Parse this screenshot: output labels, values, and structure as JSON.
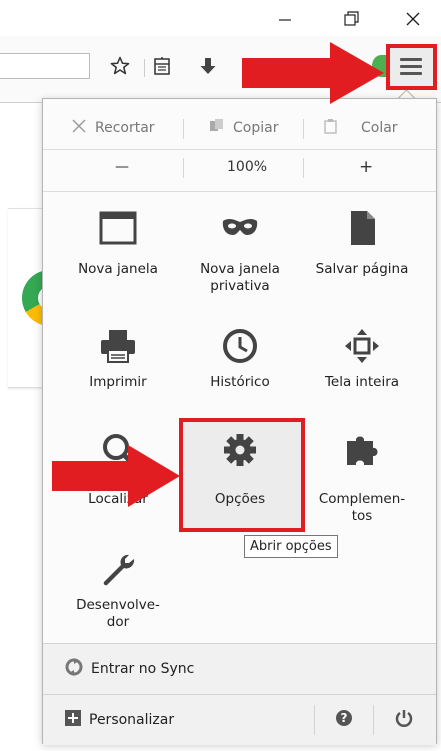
{
  "window": {
    "minimize_label": "—",
    "restore_label": "⧉",
    "close_label": "✕"
  },
  "toolbar": {
    "bookmark_icon": "star-icon",
    "reading_list_icon": "bookmarks-icon",
    "download_icon": "download-icon",
    "menu_icon": "hamburger-menu-icon"
  },
  "menu": {
    "edit": {
      "cut": "Recortar",
      "copy": "Copiar",
      "paste": "Colar"
    },
    "zoom": {
      "out": "—",
      "value": "100%",
      "in": "+"
    },
    "items": [
      {
        "label": "Nova janela",
        "icon": "window-icon"
      },
      {
        "label": "Nova janela\nprivativa",
        "icon": "mask-icon"
      },
      {
        "label": "Salvar página",
        "icon": "page-icon"
      },
      {
        "label": "Imprimir",
        "icon": "printer-icon"
      },
      {
        "label": "Histórico",
        "icon": "clock-icon"
      },
      {
        "label": "Tela inteira",
        "icon": "fullscreen-icon"
      },
      {
        "label": "Localizar",
        "icon": "search-icon"
      },
      {
        "label": "Opções",
        "icon": "gear-icon"
      },
      {
        "label": "Complemen-\ntos",
        "icon": "puzzle-icon"
      },
      {
        "label": "Desenvolve-\ndor",
        "icon": "wrench-icon"
      }
    ],
    "tooltip": "Abrir opções",
    "sync_label": "Entrar no Sync",
    "customize_label": "Personalizar"
  },
  "colors": {
    "highlight_red": "#e11d22",
    "panel_bg": "#fbfbfb",
    "footer_bg": "#f1f1f1"
  }
}
